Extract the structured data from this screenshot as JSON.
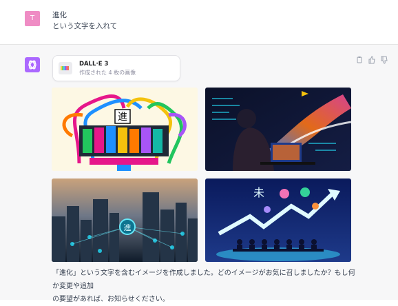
{
  "user_message": {
    "avatar_letter": "T",
    "line1": "進化",
    "line2": "という文字を入れて"
  },
  "assistant": {
    "card": {
      "title": "DALL·E 3",
      "subtitle": "作成された 4 枚の画像"
    },
    "action_icons": [
      "copy-icon",
      "thumbs-up-icon",
      "thumbs-down-icon"
    ],
    "images": [
      {
        "name": "image-1",
        "description_colors": [
          "#fdf7e0",
          "#e6178a"
        ]
      },
      {
        "name": "image-2",
        "description_colors": [
          "#0c1230",
          "#f47a2a"
        ]
      },
      {
        "name": "image-3",
        "description_colors": [
          "#1f2d40",
          "#22d3ee"
        ]
      },
      {
        "name": "image-4",
        "description_colors": [
          "#0a1a5c",
          "#38e0ff"
        ]
      }
    ],
    "image_1_glyph": "進",
    "image_3_glyph": "進",
    "image_4_glyph": "未",
    "reply_line1": "「進化」という文字を含むイメージを作成しました。どのイメージがお気に召しましたか？もし何か変更や追加",
    "reply_line2": "の要望があれば、お知らせください。"
  },
  "colors": {
    "user_avatar": "#ef8cc4",
    "assistant_avatar": "#ab68ff",
    "assistant_bg": "#f7f7f8"
  }
}
